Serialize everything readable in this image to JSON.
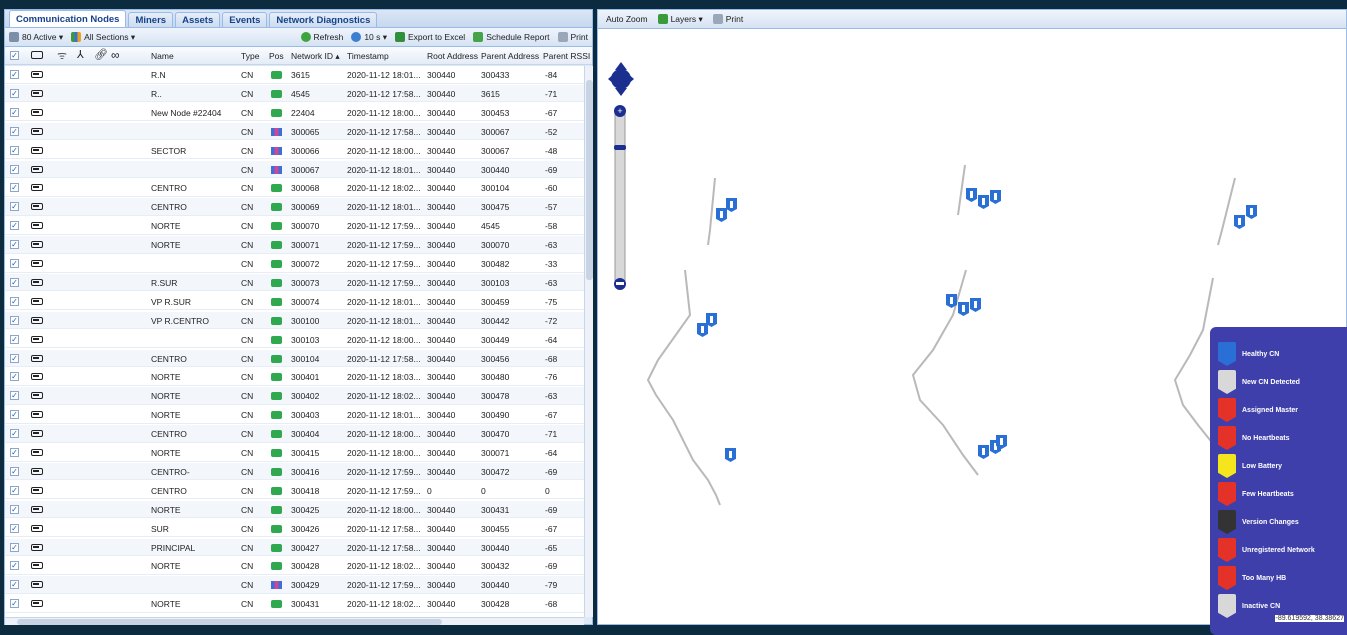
{
  "tabs": [
    {
      "label": "Communication Nodes"
    },
    {
      "label": "Miners"
    },
    {
      "label": "Assets"
    },
    {
      "label": "Events"
    },
    {
      "label": "Network Diagnostics"
    }
  ],
  "toolbar": {
    "active": "80 Active ▾",
    "sections": "All Sections ▾",
    "refresh": "Refresh",
    "interval": "10 s ▾",
    "export": "Export to Excel",
    "schedule": "Schedule Report",
    "print": "Print"
  },
  "columns": {
    "name": "Name",
    "type": "Type",
    "pos": "Pos",
    "network_id": "Network ID ▴",
    "timestamp": "Timestamp",
    "root": "Root Address",
    "parent": "Parent Address",
    "rssi": "Parent RSSI",
    "infinity": "∞"
  },
  "rows": [
    {
      "name": "R.N",
      "type": "CN",
      "pos": "green",
      "id": "3615",
      "ts": "2020-11-12 18:01...",
      "root": "300440",
      "parent": "300433",
      "rssi": "-84"
    },
    {
      "name": "R..",
      "type": "CN",
      "pos": "green",
      "id": "4545",
      "ts": "2020-11-12 17:58...",
      "root": "300440",
      "parent": "3615",
      "rssi": "-71"
    },
    {
      "name": "New Node #22404",
      "type": "CN",
      "pos": "green",
      "id": "22404",
      "ts": "2020-11-12 18:00...",
      "root": "300440",
      "parent": "300453",
      "rssi": "-67"
    },
    {
      "name": "",
      "type": "CN",
      "pos": "bars",
      "id": "300065",
      "ts": "2020-11-12 17:58...",
      "root": "300440",
      "parent": "300067",
      "rssi": "-52"
    },
    {
      "name": "SECTOR",
      "type": "CN",
      "pos": "bars",
      "id": "300066",
      "ts": "2020-11-12 18:00...",
      "root": "300440",
      "parent": "300067",
      "rssi": "-48"
    },
    {
      "name": "",
      "type": "CN",
      "pos": "bars",
      "id": "300067",
      "ts": "2020-11-12 18:01...",
      "root": "300440",
      "parent": "300440",
      "rssi": "-69"
    },
    {
      "name": "CENTRO",
      "type": "CN",
      "pos": "green",
      "id": "300068",
      "ts": "2020-11-12 18:02...",
      "root": "300440",
      "parent": "300104",
      "rssi": "-60"
    },
    {
      "name": "CENTRO",
      "type": "CN",
      "pos": "green",
      "id": "300069",
      "ts": "2020-11-12 18:01...",
      "root": "300440",
      "parent": "300475",
      "rssi": "-57"
    },
    {
      "name": "NORTE",
      "type": "CN",
      "pos": "green",
      "id": "300070",
      "ts": "2020-11-12 17:59...",
      "root": "300440",
      "parent": "4545",
      "rssi": "-58"
    },
    {
      "name": "NORTE",
      "type": "CN",
      "pos": "green",
      "id": "300071",
      "ts": "2020-11-12 17:59...",
      "root": "300440",
      "parent": "300070",
      "rssi": "-63"
    },
    {
      "name": "",
      "type": "CN",
      "pos": "green",
      "id": "300072",
      "ts": "2020-11-12 17:59...",
      "root": "300440",
      "parent": "300482",
      "rssi": "-33"
    },
    {
      "name": "R.SUR",
      "type": "CN",
      "pos": "green",
      "id": "300073",
      "ts": "2020-11-12 17:59...",
      "root": "300440",
      "parent": "300103",
      "rssi": "-63"
    },
    {
      "name": "VP R.SUR",
      "type": "CN",
      "pos": "green",
      "id": "300074",
      "ts": "2020-11-12 18:01...",
      "root": "300440",
      "parent": "300459",
      "rssi": "-75"
    },
    {
      "name": "VP R.CENTRO",
      "type": "CN",
      "pos": "green",
      "id": "300100",
      "ts": "2020-11-12 18:01...",
      "root": "300440",
      "parent": "300442",
      "rssi": "-72"
    },
    {
      "name": "",
      "type": "CN",
      "pos": "green",
      "id": "300103",
      "ts": "2020-11-12 18:00...",
      "root": "300440",
      "parent": "300449",
      "rssi": "-64"
    },
    {
      "name": "CENTRO",
      "type": "CN",
      "pos": "green",
      "id": "300104",
      "ts": "2020-11-12 17:58...",
      "root": "300440",
      "parent": "300456",
      "rssi": "-68"
    },
    {
      "name": "NORTE",
      "type": "CN",
      "pos": "green",
      "id": "300401",
      "ts": "2020-11-12 18:03...",
      "root": "300440",
      "parent": "300480",
      "rssi": "-76"
    },
    {
      "name": "NORTE",
      "type": "CN",
      "pos": "green",
      "id": "300402",
      "ts": "2020-11-12 18:02...",
      "root": "300440",
      "parent": "300478",
      "rssi": "-63"
    },
    {
      "name": "NORTE",
      "type": "CN",
      "pos": "green",
      "id": "300403",
      "ts": "2020-11-12 18:01...",
      "root": "300440",
      "parent": "300490",
      "rssi": "-67"
    },
    {
      "name": "CENTRO",
      "type": "CN",
      "pos": "green",
      "id": "300404",
      "ts": "2020-11-12 18:00...",
      "root": "300440",
      "parent": "300470",
      "rssi": "-71"
    },
    {
      "name": "NORTE",
      "type": "CN",
      "pos": "green",
      "id": "300415",
      "ts": "2020-11-12 18:00...",
      "root": "300440",
      "parent": "300071",
      "rssi": "-64"
    },
    {
      "name": "CENTRO-",
      "type": "CN",
      "pos": "green",
      "id": "300416",
      "ts": "2020-11-12 17:59...",
      "root": "300440",
      "parent": "300472",
      "rssi": "-69"
    },
    {
      "name": "CENTRO",
      "type": "CN",
      "pos": "green",
      "id": "300418",
      "ts": "2020-11-12 17:59...",
      "root": "0",
      "parent": "0",
      "rssi": "0"
    },
    {
      "name": "NORTE",
      "type": "CN",
      "pos": "green",
      "id": "300425",
      "ts": "2020-11-12 18:00...",
      "root": "300440",
      "parent": "300431",
      "rssi": "-69"
    },
    {
      "name": "SUR",
      "type": "CN",
      "pos": "green",
      "id": "300426",
      "ts": "2020-11-12 17:58...",
      "root": "300440",
      "parent": "300455",
      "rssi": "-67"
    },
    {
      "name": "PRINCIPAL",
      "type": "CN",
      "pos": "green",
      "id": "300427",
      "ts": "2020-11-12 17:58...",
      "root": "300440",
      "parent": "300440",
      "rssi": "-65"
    },
    {
      "name": "NORTE",
      "type": "CN",
      "pos": "green",
      "id": "300428",
      "ts": "2020-11-12 18:02...",
      "root": "300440",
      "parent": "300432",
      "rssi": "-69"
    },
    {
      "name": "",
      "type": "CN",
      "pos": "bars",
      "id": "300429",
      "ts": "2020-11-12 17:59...",
      "root": "300440",
      "parent": "300440",
      "rssi": "-79"
    },
    {
      "name": "NORTE",
      "type": "CN",
      "pos": "green",
      "id": "300431",
      "ts": "2020-11-12 18:02...",
      "root": "300440",
      "parent": "300428",
      "rssi": "-68"
    }
  ],
  "map": {
    "auto_zoom": "Auto Zoom",
    "layers": "Layers ▾",
    "print": "Print",
    "coords": "-89.619592, 38.38627"
  },
  "legend": [
    {
      "label": "Healthy CN",
      "color": "#2a6fd6"
    },
    {
      "label": "New CN Detected",
      "color": "#d8d8d8"
    },
    {
      "label": "Assigned Master",
      "color": "#e53228"
    },
    {
      "label": "No Heartbeats",
      "color": "#e53228"
    },
    {
      "label": "Low Battery",
      "color": "#f5e51d"
    },
    {
      "label": "Few Heartbeats",
      "color": "#e53228"
    },
    {
      "label": "Version Changes",
      "color": "#333333"
    },
    {
      "label": "Unregistered Network",
      "color": "#e53228"
    },
    {
      "label": "Too Many HB",
      "color": "#e53228"
    },
    {
      "label": "Inactive CN",
      "color": "#d8d8d8"
    }
  ]
}
